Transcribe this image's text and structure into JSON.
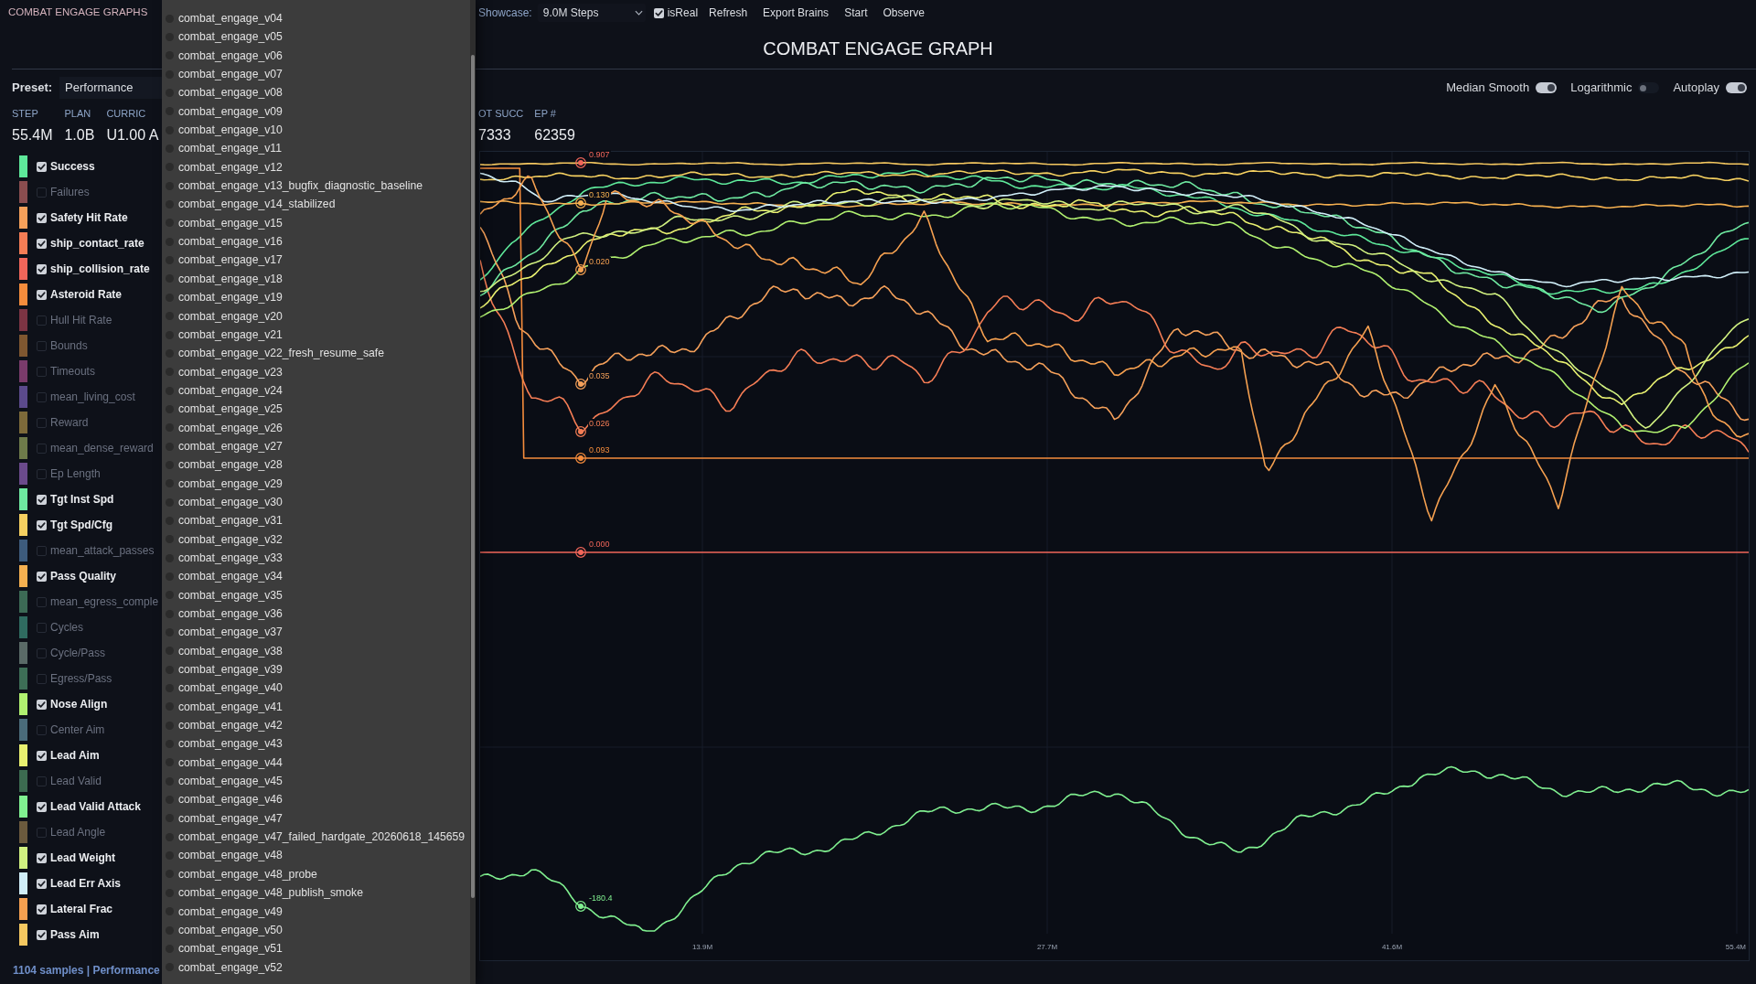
{
  "app_title": "COMBAT ENGAGE GRAPHS",
  "toolbar": {
    "showcase": {
      "label": "Showcase:",
      "value": "9.0M Steps"
    },
    "is_real": {
      "label": "isReal",
      "checked": true
    },
    "buttons": [
      "Refresh",
      "Export Brains",
      "Start",
      "Observe"
    ]
  },
  "graph_title": "COMBAT ENGAGE GRAPH",
  "preset": {
    "label": "Preset:",
    "value": "Performance"
  },
  "toggles": [
    {
      "label": "Median Smooth",
      "on": true
    },
    {
      "label": "Logarithmic",
      "on": false
    },
    {
      "label": "Autoplay",
      "on": true
    }
  ],
  "stats": {
    "left": [
      {
        "label": "STEP",
        "value": "55.4M"
      },
      {
        "label": "PLAN",
        "value": "1.0B"
      },
      {
        "label": "CURRIC",
        "value": "U1.00 A"
      }
    ],
    "right": [
      {
        "label": "OT SUCC",
        "value": "7333"
      },
      {
        "label": "EP #",
        "value": "62359"
      }
    ]
  },
  "metrics": [
    {
      "name": "Success",
      "color": "#5ee89a",
      "checked": true
    },
    {
      "name": "Failures",
      "color": "#8a4d4f",
      "checked": false
    },
    {
      "name": "Safety Hit Rate",
      "color": "#f5a05a",
      "checked": true
    },
    {
      "name": "ship_contact_rate",
      "color": "#f57d55",
      "checked": true
    },
    {
      "name": "ship_collision_rate",
      "color": "#f2665a",
      "checked": true
    },
    {
      "name": "Asteroid Rate",
      "color": "#f58c3c",
      "checked": true
    },
    {
      "name": "Hull Hit Rate",
      "color": "#7c3443",
      "checked": false
    },
    {
      "name": "Bounds",
      "color": "#7f5730",
      "checked": false
    },
    {
      "name": "Timeouts",
      "color": "#7a3b6b",
      "checked": false
    },
    {
      "name": "mean_living_cost",
      "color": "#5b4a8c",
      "checked": false
    },
    {
      "name": "Reward",
      "color": "#7d6a3a",
      "checked": false
    },
    {
      "name": "mean_dense_reward",
      "color": "#6e7b4a",
      "checked": false
    },
    {
      "name": "Ep Length",
      "color": "#6b4a8c",
      "checked": false
    },
    {
      "name": "Tgt Inst Spd",
      "color": "#6ee8a0",
      "checked": true
    },
    {
      "name": "Tgt Spd/Cfg",
      "color": "#f5d060",
      "checked": true
    },
    {
      "name": "mean_attack_passes",
      "color": "#3d5b7c",
      "checked": false
    },
    {
      "name": "Pass Quality",
      "color": "#f5b050",
      "checked": true
    },
    {
      "name": "mean_egress_comple",
      "color": "#3c6a55",
      "checked": false
    },
    {
      "name": "Cycles",
      "color": "#2f6b60",
      "checked": false
    },
    {
      "name": "Cycle/Pass",
      "color": "#5a6a67",
      "checked": false
    },
    {
      "name": "Egress/Pass",
      "color": "#3d6e56",
      "checked": false
    },
    {
      "name": "Nose Align",
      "color": "#b0f070",
      "checked": true
    },
    {
      "name": "Center Aim",
      "color": "#4a6b7a",
      "checked": false
    },
    {
      "name": "Lead Aim",
      "color": "#e8f070",
      "checked": true
    },
    {
      "name": "Lead Valid",
      "color": "#3c6b50",
      "checked": false
    },
    {
      "name": "Lead Valid Attack",
      "color": "#80f090",
      "checked": true
    },
    {
      "name": "Lead Angle",
      "color": "#6b5a3d",
      "checked": false
    },
    {
      "name": "Lead Weight",
      "color": "#d0f080",
      "checked": true
    },
    {
      "name": "Lead Err Axis",
      "color": "#d0eef8",
      "checked": true
    },
    {
      "name": "Lateral Frac",
      "color": "#f5a050",
      "checked": true
    },
    {
      "name": "Pass Aim",
      "color": "#f5c860",
      "checked": true
    }
  ],
  "status_text": "1104 samples | Performance",
  "chart": {
    "hover_points": [
      {
        "value": "0.907",
        "color": "#f2665a"
      },
      {
        "value": "0.130",
        "color": "#f5b050"
      },
      {
        "value": "0.020",
        "color": "#f5a050"
      },
      {
        "value": "0.035",
        "color": "#f5a05a"
      },
      {
        "value": "0.026",
        "color": "#f57d55"
      },
      {
        "value": "0.093",
        "color": "#f58c3c"
      },
      {
        "value": "0.000",
        "color": "#f2665a"
      },
      {
        "value": "-180.4",
        "color": "#80f090"
      }
    ],
    "x_labels": [
      "13.9M",
      "27.7M",
      "41.6M",
      "55.4M"
    ]
  },
  "run_dropdown": {
    "items": [
      {
        "label": "combat_engage_v04",
        "selected": false
      },
      {
        "label": "combat_engage_v05",
        "selected": false
      },
      {
        "label": "combat_engage_v06",
        "selected": false
      },
      {
        "label": "combat_engage_v07",
        "selected": false
      },
      {
        "label": "combat_engage_v08",
        "selected": false
      },
      {
        "label": "combat_engage_v09",
        "selected": false
      },
      {
        "label": "combat_engage_v10",
        "selected": false
      },
      {
        "label": "combat_engage_v11",
        "selected": false
      },
      {
        "label": "combat_engage_v12",
        "selected": false
      },
      {
        "label": "combat_engage_v13_bugfix_diagnostic_baseline",
        "selected": false
      },
      {
        "label": "combat_engage_v14_stabilized",
        "selected": false
      },
      {
        "label": "combat_engage_v15",
        "selected": false
      },
      {
        "label": "combat_engage_v16",
        "selected": false
      },
      {
        "label": "combat_engage_v17",
        "selected": false
      },
      {
        "label": "combat_engage_v18",
        "selected": false
      },
      {
        "label": "combat_engage_v19",
        "selected": false
      },
      {
        "label": "combat_engage_v20",
        "selected": false
      },
      {
        "label": "combat_engage_v21",
        "selected": false
      },
      {
        "label": "combat_engage_v22_fresh_resume_safe",
        "selected": false
      },
      {
        "label": "combat_engage_v23",
        "selected": false
      },
      {
        "label": "combat_engage_v24",
        "selected": false
      },
      {
        "label": "combat_engage_v25",
        "selected": false
      },
      {
        "label": "combat_engage_v26",
        "selected": false
      },
      {
        "label": "combat_engage_v27",
        "selected": false
      },
      {
        "label": "combat_engage_v28",
        "selected": false
      },
      {
        "label": "combat_engage_v29",
        "selected": false
      },
      {
        "label": "combat_engage_v30",
        "selected": false
      },
      {
        "label": "combat_engage_v31",
        "selected": false
      },
      {
        "label": "combat_engage_v32",
        "selected": false
      },
      {
        "label": "combat_engage_v33",
        "selected": false
      },
      {
        "label": "combat_engage_v34",
        "selected": false
      },
      {
        "label": "combat_engage_v35",
        "selected": false
      },
      {
        "label": "combat_engage_v36",
        "selected": false
      },
      {
        "label": "combat_engage_v37",
        "selected": false
      },
      {
        "label": "combat_engage_v38",
        "selected": false
      },
      {
        "label": "combat_engage_v39",
        "selected": false
      },
      {
        "label": "combat_engage_v40",
        "selected": false
      },
      {
        "label": "combat_engage_v41",
        "selected": false
      },
      {
        "label": "combat_engage_v42",
        "selected": false
      },
      {
        "label": "combat_engage_v43",
        "selected": false
      },
      {
        "label": "combat_engage_v44",
        "selected": false
      },
      {
        "label": "combat_engage_v45",
        "selected": false
      },
      {
        "label": "combat_engage_v46",
        "selected": false
      },
      {
        "label": "combat_engage_v47",
        "selected": false
      },
      {
        "label": "combat_engage_v47_failed_hardgate_20260618_145659",
        "selected": false
      },
      {
        "label": "combat_engage_v48",
        "selected": false
      },
      {
        "label": "combat_engage_v48_probe",
        "selected": false
      },
      {
        "label": "combat_engage_v48_publish_smoke",
        "selected": false
      },
      {
        "label": "combat_engage_v49",
        "selected": false
      },
      {
        "label": "combat_engage_v50",
        "selected": false
      },
      {
        "label": "combat_engage_v51",
        "selected": false
      },
      {
        "label": "combat_engage_v52",
        "selected": false
      }
    ]
  }
}
